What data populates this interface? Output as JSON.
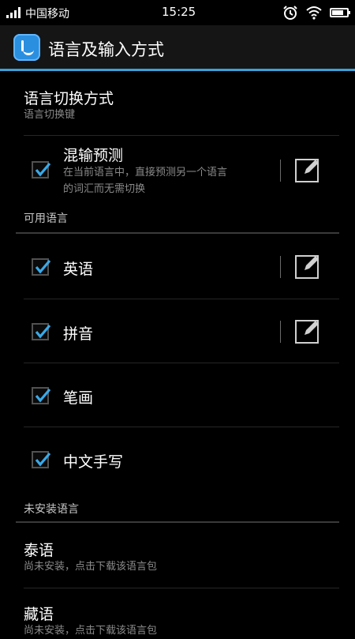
{
  "status": {
    "carrier": "中国移动",
    "time": "15:25",
    "battery_level": 0.8
  },
  "app": {
    "title": "语言及输入方式"
  },
  "switch_method": {
    "title": "语言切换方式",
    "subtitle": "语言切换键"
  },
  "mixed_input": {
    "title": "混输预测",
    "desc_line1": "在当前语言中，直接预测另一个语言",
    "desc_line2": "的词汇而无需切换",
    "checked": true
  },
  "available_section": {
    "label": "可用语言"
  },
  "available_languages": [
    {
      "label": "英语",
      "checked": true,
      "editable": true
    },
    {
      "label": "拼音",
      "checked": true,
      "editable": true
    },
    {
      "label": "笔画",
      "checked": true,
      "editable": false
    },
    {
      "label": "中文手写",
      "checked": true,
      "editable": false
    }
  ],
  "uninstalled_section": {
    "label": "未安装语言"
  },
  "uninstalled_languages": [
    {
      "name": "泰语",
      "status": "尚未安装，点击下载该语言包"
    },
    {
      "name": "藏语",
      "status": "尚未安装，点击下载该语言包"
    }
  ]
}
